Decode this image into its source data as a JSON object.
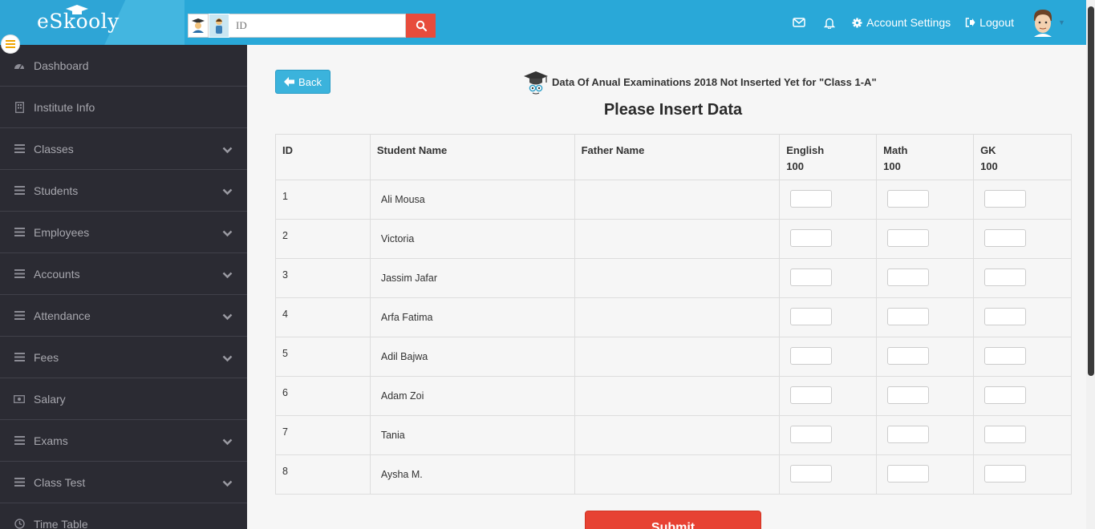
{
  "header": {
    "logo_text": "eSkooly",
    "search_placeholder": "ID",
    "account_settings": "Account Settings",
    "logout": "Logout"
  },
  "sidebar": {
    "items": [
      {
        "label": "Dashboard",
        "icon": "dashboard-icon",
        "chevron": false
      },
      {
        "label": "Institute Info",
        "icon": "building-icon",
        "chevron": false
      },
      {
        "label": "Classes",
        "icon": "menu-lines-icon",
        "chevron": true
      },
      {
        "label": "Students",
        "icon": "menu-lines-icon",
        "chevron": true
      },
      {
        "label": "Employees",
        "icon": "menu-lines-icon",
        "chevron": true
      },
      {
        "label": "Accounts",
        "icon": "menu-lines-icon",
        "chevron": true
      },
      {
        "label": "Attendance",
        "icon": "menu-lines-icon",
        "chevron": true
      },
      {
        "label": "Fees",
        "icon": "menu-lines-icon",
        "chevron": true
      },
      {
        "label": "Salary",
        "icon": "money-icon",
        "chevron": false
      },
      {
        "label": "Exams",
        "icon": "menu-lines-icon",
        "chevron": true
      },
      {
        "label": "Class Test",
        "icon": "menu-lines-icon",
        "chevron": true
      },
      {
        "label": "Time Table",
        "icon": "clock-icon",
        "chevron": false
      }
    ]
  },
  "main": {
    "back_label": "Back",
    "notice": "Data Of Anual Examinations 2018 Not Inserted Yet for \"Class 1-A\"",
    "title": "Please Insert Data",
    "columns": {
      "id": "ID",
      "student_name": "Student Name",
      "father_name": "Father Name",
      "english": "English",
      "english_total": "100",
      "math": "Math",
      "math_total": "100",
      "gk": "GK",
      "gk_total": "100"
    },
    "rows": [
      {
        "id": "1",
        "name": "Ali Mousa",
        "father": ""
      },
      {
        "id": "2",
        "name": "Victoria",
        "father": ""
      },
      {
        "id": "3",
        "name": "Jassim Jafar",
        "father": ""
      },
      {
        "id": "4",
        "name": "Arfa Fatima",
        "father": ""
      },
      {
        "id": "5",
        "name": "Adil Bajwa",
        "father": ""
      },
      {
        "id": "6",
        "name": "Adam Zoi",
        "father": ""
      },
      {
        "id": "7",
        "name": "Tania",
        "father": ""
      },
      {
        "id": "8",
        "name": "Aysha M.",
        "father": ""
      }
    ],
    "submit_label": "Submit"
  },
  "colors": {
    "topbar": "#29a8d8",
    "sidebar": "#2b2b33",
    "accent_red": "#e74c3c",
    "back_button": "#3bb3dc"
  }
}
